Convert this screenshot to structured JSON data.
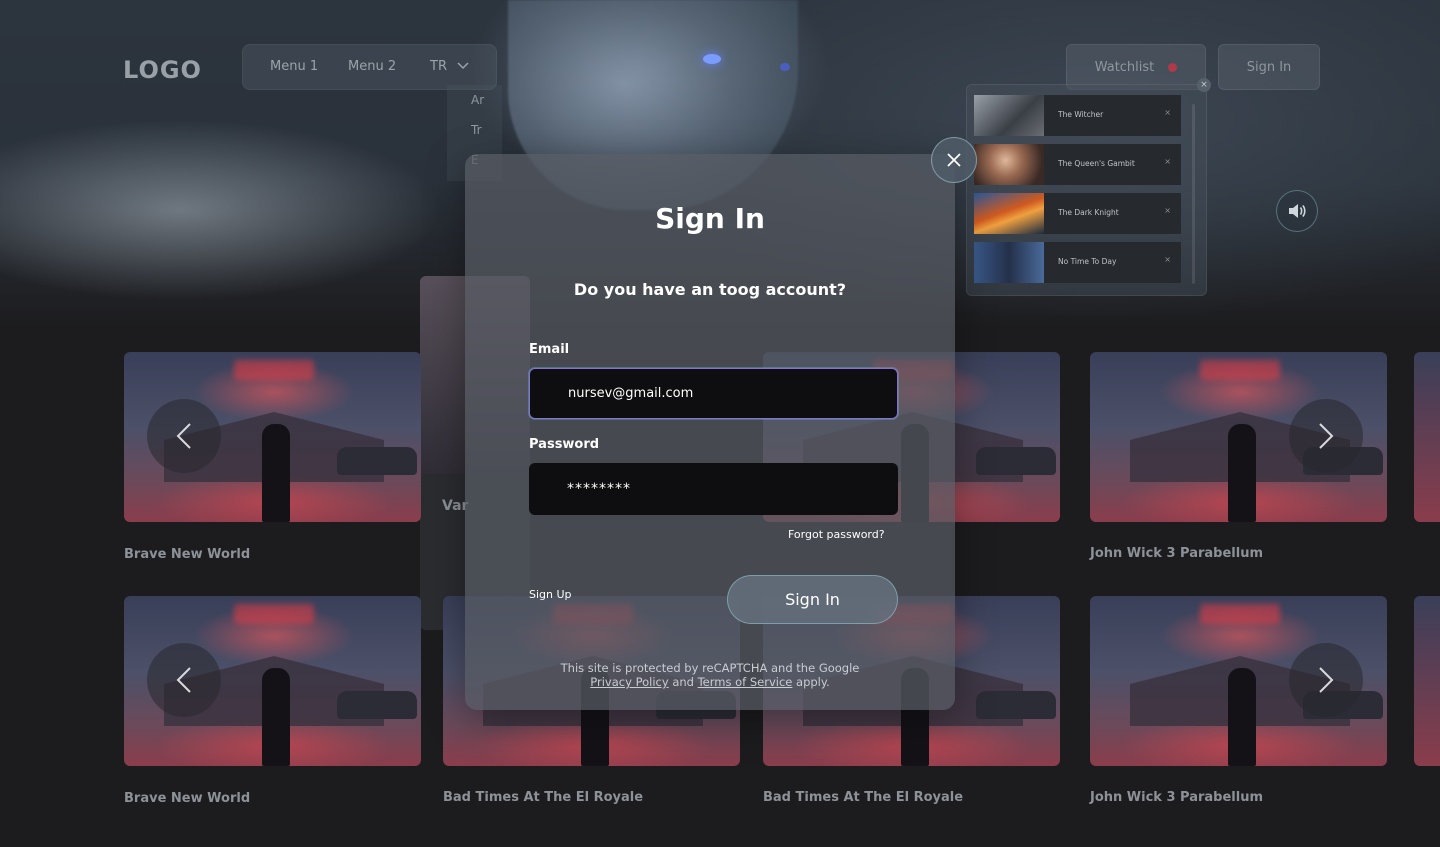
{
  "header": {
    "logo": "LOGO",
    "menu": [
      "Menu 1",
      "Menu 2"
    ],
    "lang_selected": "TR",
    "lang_options": [
      "Ar",
      "Tr",
      "E"
    ],
    "watchlist_label": "Watchlist",
    "signin_label": "Sign In"
  },
  "watchlist": {
    "items": [
      {
        "title": "The Witcher"
      },
      {
        "title": "The Queen's Gambit"
      },
      {
        "title": "The Dark Knight"
      },
      {
        "title": "No Time To Day"
      }
    ],
    "item_close": "×",
    "panel_close": "×"
  },
  "rows": [
    {
      "titles": [
        "Brave New World",
        "",
        "",
        "John Wick 3 Parabellum"
      ]
    },
    {
      "titles": [
        "Brave New World",
        "Bad Times At The El Royale",
        "Bad Times At The El Royale",
        "John Wick 3 Parabellum"
      ]
    }
  ],
  "background_panel_text": "Var",
  "modal": {
    "title": "Sign In",
    "question": "Do you have an toog account?",
    "email_label": "Email",
    "email_value": "nursev@gmail.com",
    "password_label": "Password",
    "password_value": "********",
    "forgot": "Forgot password?",
    "signup": "Sign Up",
    "submit": "Sign In",
    "recaptcha_line1": "This site is protected by reCAPTCHA and the Google",
    "privacy": "Privacy Policy",
    "and": "and",
    "terms": "Terms of Service",
    "apply": "apply."
  },
  "colors": {
    "accent": "#8a6fd6",
    "bg": "#1c1c1e",
    "watchlist_dot": "#b0394a"
  }
}
